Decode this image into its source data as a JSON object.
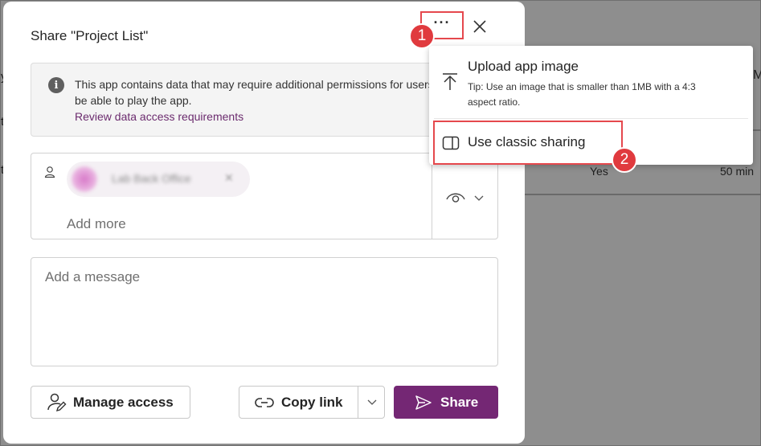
{
  "background": {
    "left_fragments": [
      "y",
      "t",
      "t"
    ],
    "right_fragments": [
      "M"
    ],
    "row": {
      "yes_text": "Yes",
      "duration_text": "50 min"
    }
  },
  "dialog": {
    "title": "Share \"Project List\"",
    "more_label": "···",
    "info": {
      "text": "This app contains data that may require additional permissions for users to be able to play the app.",
      "link": "Review data access requirements"
    },
    "people": {
      "chip_name": "Lab Back Office",
      "chip_remove": "✕",
      "add_more_placeholder": "Add more"
    },
    "message": {
      "placeholder": "Add a message"
    },
    "buttons": {
      "manage_access": "Manage access",
      "copy_link": "Copy link",
      "share": "Share"
    }
  },
  "menu": {
    "upload_title": "Upload app image",
    "upload_tip": "Tip: Use an image that is smaller than 1MB with a 4:3 aspect ratio.",
    "classic_sharing": "Use classic sharing"
  },
  "badges": {
    "step1": "1",
    "step2": "2"
  },
  "colors": {
    "accent": "#742774",
    "link": "#6b2b6e",
    "highlight": "#e5484d",
    "badge": "#e03a3e"
  }
}
